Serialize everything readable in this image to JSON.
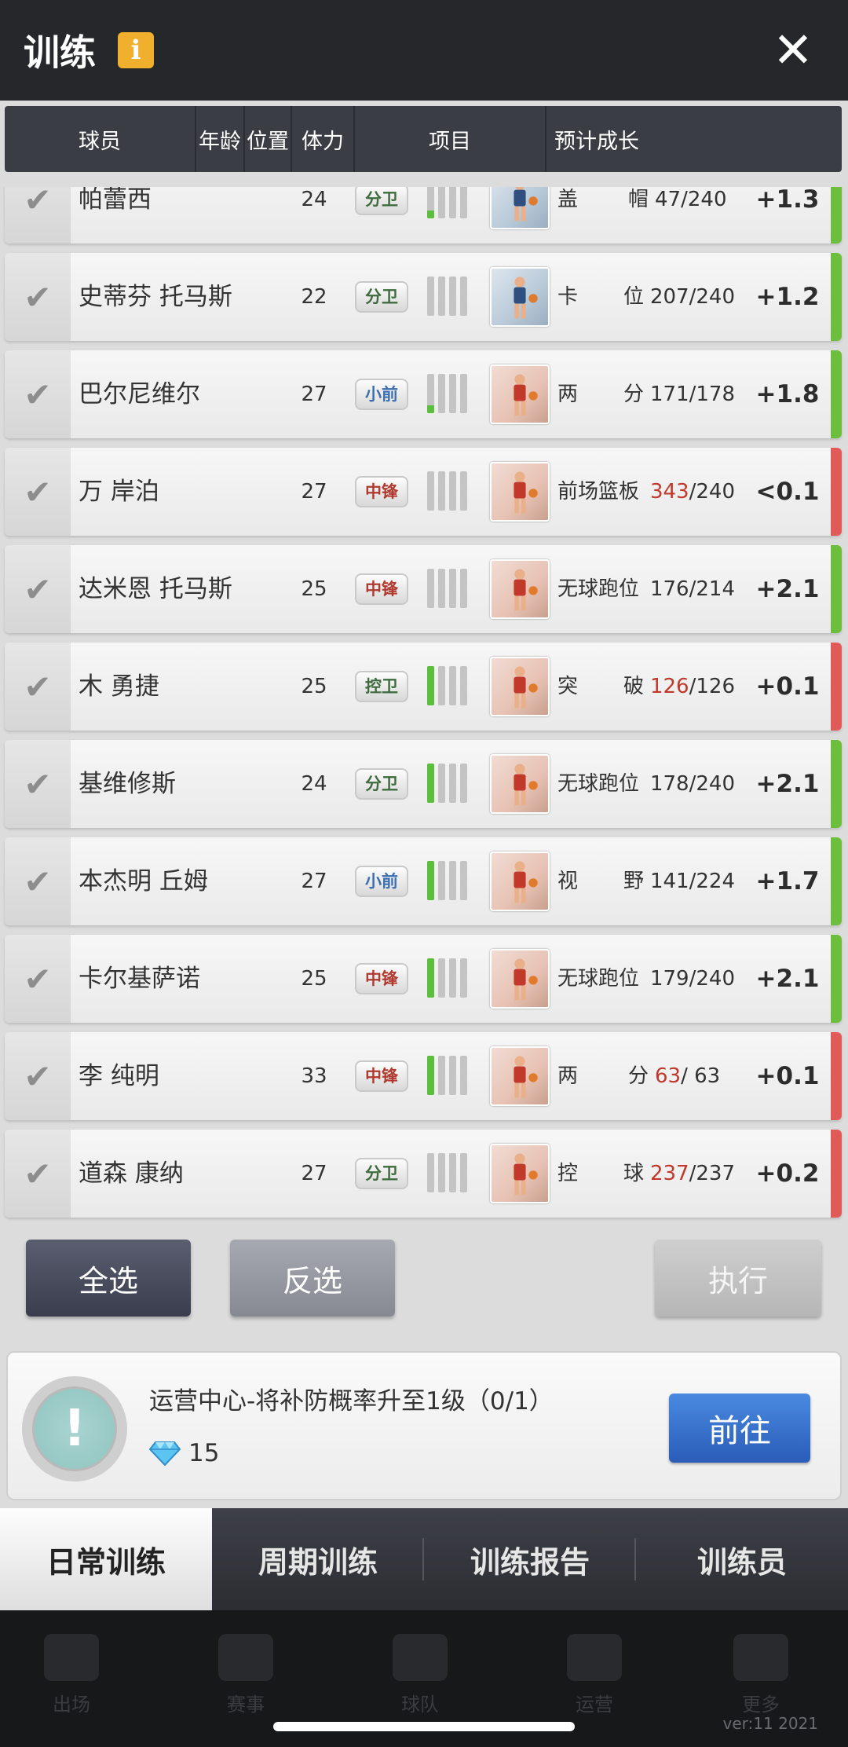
{
  "header": {
    "title": "训练",
    "info": "i",
    "close": "✕"
  },
  "columns": [
    "球员",
    "年龄",
    "位置",
    "体力",
    "项目",
    "预计成长"
  ],
  "rows": [
    {
      "name": "帕蕾西",
      "age": "24",
      "pos": "分卫",
      "posClass": "sg",
      "stamina": "low",
      "thumb": "blue",
      "item_a": "盖",
      "item_b": "帽",
      "cur": "47",
      "max": "/240",
      "curRed": false,
      "growth": "+1.3",
      "bar": "green"
    },
    {
      "name": "史蒂芬 托马斯",
      "age": "22",
      "pos": "分卫",
      "posClass": "sg",
      "stamina": "none",
      "thumb": "blue",
      "item_a": "卡",
      "item_b": "位",
      "cur": "207",
      "max": "/240",
      "curRed": false,
      "growth": "+1.2",
      "bar": "green"
    },
    {
      "name": "巴尔尼维尔",
      "age": "27",
      "pos": "小前",
      "posClass": "sf",
      "stamina": "low",
      "thumb": "red",
      "item_a": "两",
      "item_b": "分",
      "cur": "171",
      "max": "/178",
      "curRed": false,
      "growth": "+1.8",
      "bar": "green"
    },
    {
      "name": "万 岸泊",
      "age": "27",
      "pos": "中锋",
      "posClass": "c",
      "stamina": "none",
      "thumb": "red",
      "item_a": "前场篮板",
      "item_b": "",
      "cur": "343",
      "max": "/240",
      "curRed": true,
      "growth": "<0.1",
      "bar": "red"
    },
    {
      "name": "达米恩 托马斯",
      "age": "25",
      "pos": "中锋",
      "posClass": "c",
      "stamina": "none",
      "thumb": "red",
      "item_a": "无球跑位",
      "item_b": "",
      "cur": "176",
      "max": "/214",
      "curRed": false,
      "growth": "+2.1",
      "bar": "green"
    },
    {
      "name": "木 勇捷",
      "age": "25",
      "pos": "控卫",
      "posClass": "pg",
      "stamina": "mid",
      "thumb": "red",
      "item_a": "突",
      "item_b": "破",
      "cur": "126",
      "max": "/126",
      "curRed": true,
      "growth": "+0.1",
      "bar": "red"
    },
    {
      "name": "基维修斯",
      "age": "24",
      "pos": "分卫",
      "posClass": "sg",
      "stamina": "mid",
      "thumb": "red",
      "item_a": "无球跑位",
      "item_b": "",
      "cur": "178",
      "max": "/240",
      "curRed": false,
      "growth": "+2.1",
      "bar": "green"
    },
    {
      "name": "本杰明 丘姆",
      "age": "27",
      "pos": "小前",
      "posClass": "sf",
      "stamina": "mid",
      "thumb": "red",
      "item_a": "视",
      "item_b": "野",
      "cur": "141",
      "max": "/224",
      "curRed": false,
      "growth": "+1.7",
      "bar": "green"
    },
    {
      "name": "卡尔基萨诺",
      "age": "25",
      "pos": "中锋",
      "posClass": "c",
      "stamina": "mid",
      "thumb": "red",
      "item_a": "无球跑位",
      "item_b": "",
      "cur": "179",
      "max": "/240",
      "curRed": false,
      "growth": "+2.1",
      "bar": "green"
    },
    {
      "name": "李 纯明",
      "age": "33",
      "pos": "中锋",
      "posClass": "c",
      "stamina": "mid",
      "thumb": "red",
      "item_a": "两",
      "item_b": "分",
      "cur": "63",
      "max": "/ 63",
      "curRed": true,
      "growth": "+0.1",
      "bar": "red"
    },
    {
      "name": "道森 康纳",
      "age": "27",
      "pos": "分卫",
      "posClass": "sg",
      "stamina": "none",
      "thumb": "red",
      "item_a": "控",
      "item_b": "球",
      "cur": "237",
      "max": "/237",
      "curRed": true,
      "growth": "+0.2",
      "bar": "red"
    }
  ],
  "buttons": {
    "select_all": "全选",
    "invert": "反选",
    "execute": "执行"
  },
  "task": {
    "desc": "运营中心-将补防概率升至1级（0/1）",
    "reward": "15",
    "go": "前往"
  },
  "tabs": [
    "日常训练",
    "周期训练",
    "训练报告",
    "训练员"
  ],
  "bottom_nav": [
    "出场",
    "赛事",
    "球队",
    "运营",
    "更多"
  ],
  "version": "ver:11  2021",
  "colors": {
    "green": "#6cbe3c",
    "red": "#e05b57",
    "accent_blue": "#2a5cb8"
  }
}
